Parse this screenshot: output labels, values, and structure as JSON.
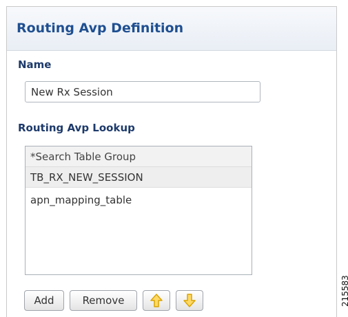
{
  "panel": {
    "title": "Routing Avp Definition"
  },
  "name_section": {
    "label": "Name",
    "value": "New Rx Session"
  },
  "lookup_section": {
    "label": "Routing Avp Lookup",
    "items": [
      "*Search Table Group",
      "TB_RX_NEW_SESSION",
      "apn_mapping_table"
    ]
  },
  "buttons": {
    "add": "Add",
    "remove": "Remove",
    "move_up_icon": "arrow-up-icon",
    "move_down_icon": "arrow-down-icon"
  },
  "colors": {
    "title": "#1f4f91",
    "label": "#1d3a6b",
    "arrow_fill": "#ffd966",
    "arrow_stroke": "#d9a400"
  },
  "figure_id": "215583"
}
